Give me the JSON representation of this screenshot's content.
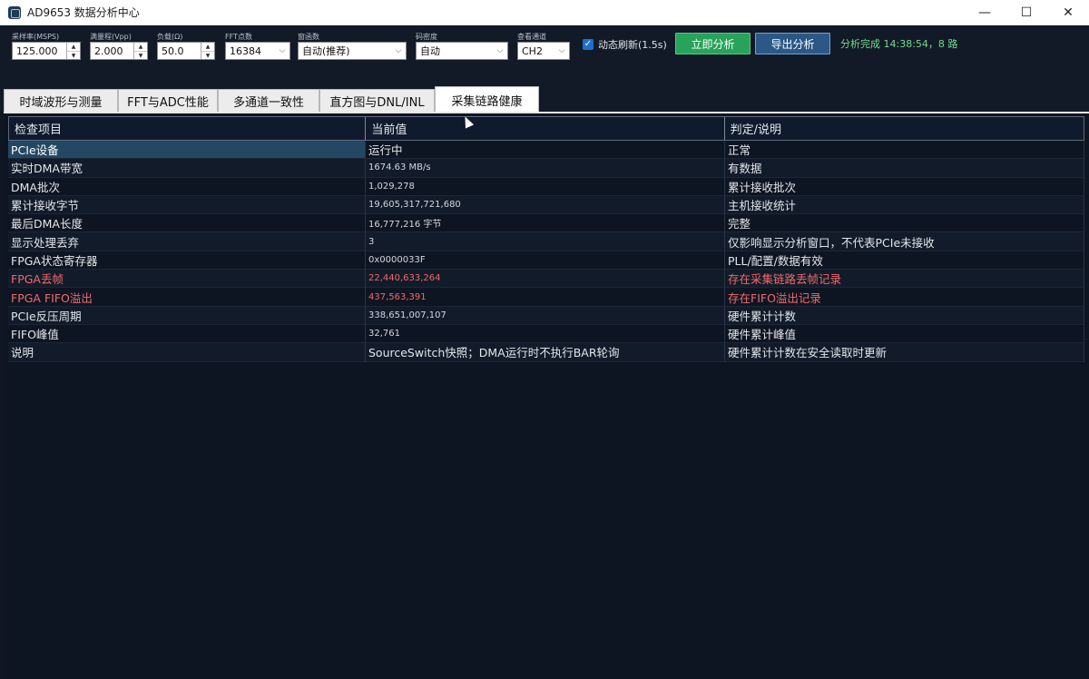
{
  "window": {
    "title": "AD9653 数据分析中心",
    "controls": {
      "minimize": "—",
      "maximize": "☐",
      "close": "✕"
    }
  },
  "toolbar": {
    "sample_rate": {
      "label": "采样率(MSPS)",
      "value": "125.000"
    },
    "range": {
      "label": "满量程(Vpp)",
      "value": "2.000"
    },
    "load": {
      "label": "负载(Ω)",
      "value": "50.0"
    },
    "fft_points": {
      "label": "FFT点数",
      "value": "16384"
    },
    "window_fn": {
      "label": "窗函数",
      "value": "自动(推荐)"
    },
    "density": {
      "label": "码密度",
      "value": "自动"
    },
    "channel": {
      "label": "查看通道",
      "value": "CH2"
    },
    "auto_refresh": {
      "label": "动态刷新(1.5s)",
      "checked": true
    },
    "analyze_button": "立即分析",
    "export_button": "导出分析",
    "status": "分析完成 14:38:54，8 路"
  },
  "tabs": [
    {
      "label": "时域波形与测量"
    },
    {
      "label": "FFT与ADC性能"
    },
    {
      "label": "多通道一致性"
    },
    {
      "label": "直方图与DNL/INL"
    },
    {
      "label": "采集链路健康",
      "active": true
    }
  ],
  "table": {
    "headers": [
      "检查项目",
      "当前值",
      "判定/说明"
    ],
    "rows": [
      {
        "item": "PCIe设备",
        "value": "运行中",
        "note": "正常",
        "state": "selected"
      },
      {
        "item": "实时DMA带宽",
        "value": "1674.63 MB/s",
        "note": "有数据"
      },
      {
        "item": "DMA批次",
        "value": "1,029,278",
        "note": "累计接收批次"
      },
      {
        "item": "累计接收字节",
        "value": "19,605,317,721,680",
        "note": "主机接收统计"
      },
      {
        "item": "最后DMA长度",
        "value": "16,777,216 字节",
        "note": "完整"
      },
      {
        "item": "显示处理丢弃",
        "value": "3",
        "note": "仅影响显示分析窗口，不代表PCIe未接收"
      },
      {
        "item": "FPGA状态寄存器",
        "value": "0x0000033F",
        "note": "PLL/配置/数据有效"
      },
      {
        "item": "FPGA丢帧",
        "value": "22,440,633,264",
        "note": "存在采集链路丢帧记录",
        "state": "bad"
      },
      {
        "item": "FPGA FIFO溢出",
        "value": "437,563,391",
        "note": "存在FIFO溢出记录",
        "state": "bad"
      },
      {
        "item": "PCIe反压周期",
        "value": "338,651,007,107",
        "note": "硬件累计计数"
      },
      {
        "item": "FIFO峰值",
        "value": "32,761",
        "note": "硬件累计峰值"
      },
      {
        "item": "说明",
        "value": "SourceSwitch快照；DMA运行时不执行BAR轮询",
        "note": "硬件累计计数在安全读取时更新"
      }
    ]
  },
  "colors": {
    "background": "#0f1521",
    "accent_green": "#27a35a",
    "accent_blue": "#2b5886",
    "status_green": "#6fdc8c",
    "error_red": "#f06a6a",
    "selected_row": "#244763"
  },
  "icons": {
    "app": "app-chip-icon",
    "cursor": "mouse-cursor-icon"
  }
}
